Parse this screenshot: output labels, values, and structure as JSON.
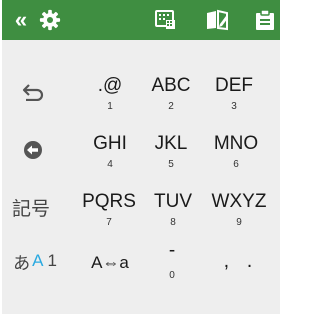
{
  "colors": {
    "toolbar_bg": "#3f8e41",
    "keys_bg": "#eeeeee",
    "accent": "#2aa9e0"
  },
  "toolbar": {
    "icons": [
      "collapse-icon",
      "gear-icon",
      "keypad-icon",
      "dictionary-edit-icon",
      "clipboard-icon"
    ],
    "collapse_label": "«"
  },
  "keys": {
    "row1": {
      "left_icon": "undo-arrow-icon",
      "k1": {
        "main": ".@",
        "sub": "1"
      },
      "k2": {
        "main": "ABC",
        "sub": "2"
      },
      "k3": {
        "main": "DEF",
        "sub": "3"
      }
    },
    "row2": {
      "left_icon": "left-arrow-circle-icon",
      "k1": {
        "main": "GHI",
        "sub": "4"
      },
      "k2": {
        "main": "JKL",
        "sub": "5"
      },
      "k3": {
        "main": "MNO",
        "sub": "6"
      }
    },
    "row3": {
      "left_label": "記号",
      "k1": {
        "main": "PQRS",
        "sub": "7"
      },
      "k2": {
        "main": "TUV",
        "sub": "8"
      },
      "k3": {
        "main": "WXYZ",
        "sub": "9"
      }
    },
    "row4": {
      "mode_prefix": "あ",
      "mode_a": "A",
      "mode_1": "1",
      "k1": {
        "main": "A⇔a"
      },
      "k2": {
        "main": "-",
        "sub": "0"
      },
      "k3": {
        "main": ", ."
      }
    }
  }
}
